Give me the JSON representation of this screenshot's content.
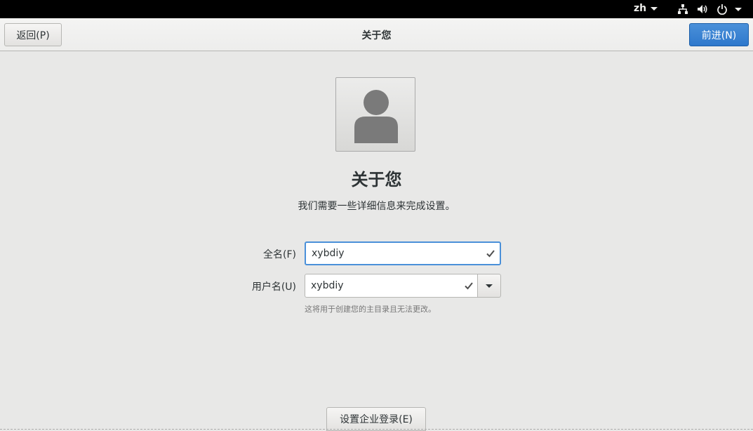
{
  "topbar": {
    "language": "zh",
    "icons": [
      "network-icon",
      "volume-icon",
      "power-icon"
    ]
  },
  "header": {
    "back_label": "返回(P)",
    "title": "关于您",
    "next_label": "前进(N)"
  },
  "main": {
    "title": "关于您",
    "subtitle": "我们需要一些详细信息来完成设置。",
    "fullname_label": "全名(F)",
    "fullname_value": "xybdiy",
    "username_label": "用户名(U)",
    "username_value": "xybdiy",
    "hint": "这将用于创建您的主目录且无法更改。",
    "enterprise_label": "设置企业登录(E)"
  },
  "colors": {
    "accent": "#4a90d9",
    "background": "#e8e8e7"
  }
}
